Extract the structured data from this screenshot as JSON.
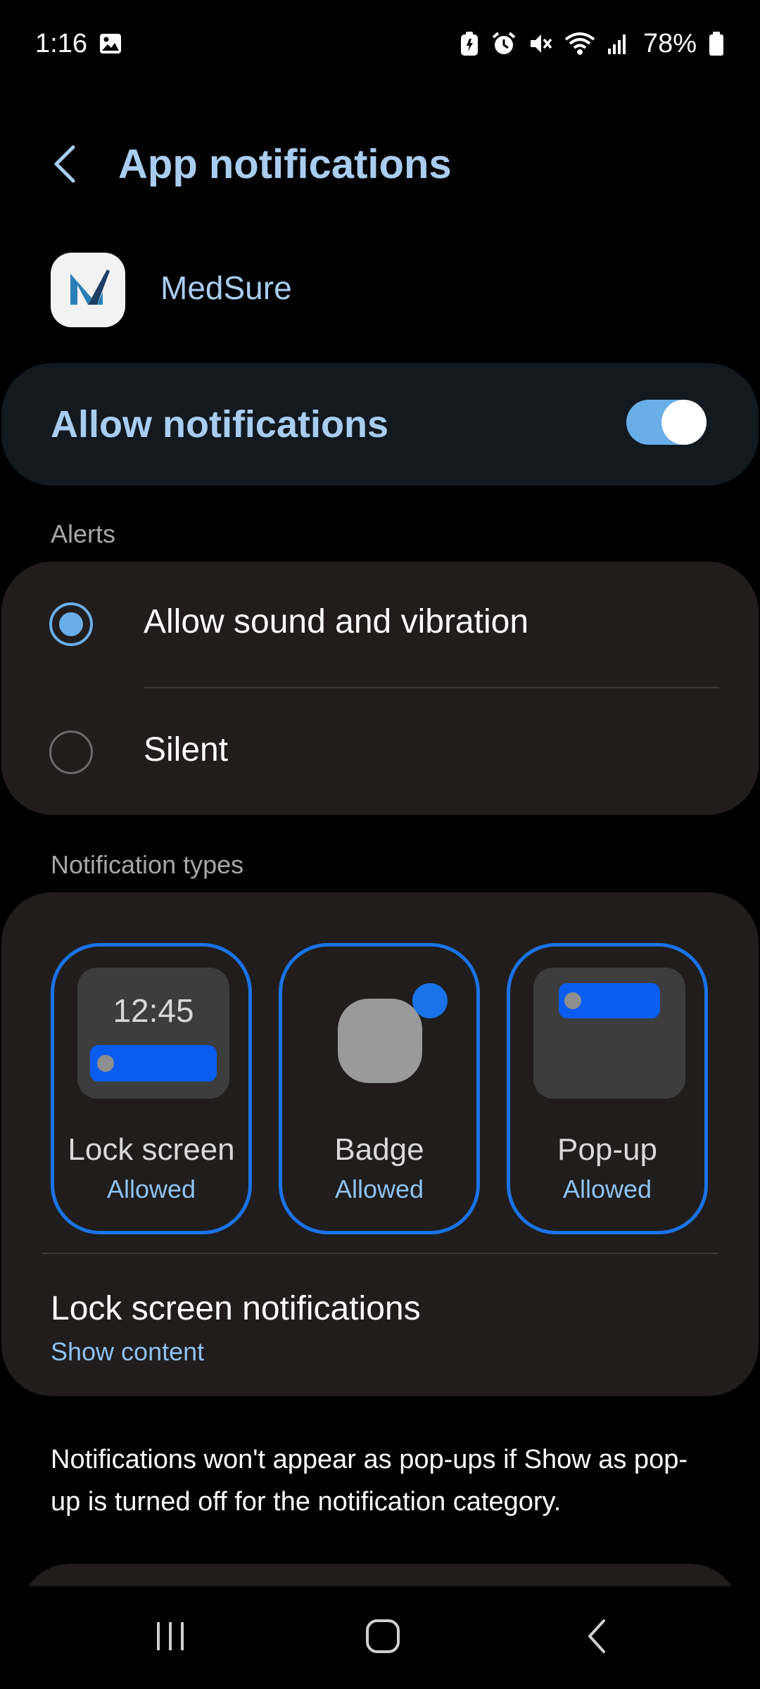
{
  "status_bar": {
    "time": "1:16",
    "battery_percent": "78%",
    "icons": [
      "image-icon",
      "battery-saver-icon",
      "alarm-icon",
      "mute-icon",
      "wifi-icon",
      "signal-icon",
      "battery-icon"
    ]
  },
  "header": {
    "title": "App notifications",
    "back_icon": "chevron-left-icon"
  },
  "app": {
    "name": "MedSure",
    "icon": "medsure-logo"
  },
  "allow_notifications": {
    "label": "Allow notifications",
    "enabled": true
  },
  "alerts": {
    "header": "Alerts",
    "options": [
      {
        "label": "Allow sound and vibration",
        "selected": true
      },
      {
        "label": "Silent",
        "selected": false
      }
    ]
  },
  "notification_types": {
    "header": "Notification types",
    "tiles": [
      {
        "label": "Lock screen",
        "status": "Allowed",
        "preview_time": "12:45"
      },
      {
        "label": "Badge",
        "status": "Allowed"
      },
      {
        "label": "Pop-up",
        "status": "Allowed"
      }
    ],
    "lock_screen_notifications": {
      "title": "Lock screen notifications",
      "value": "Show content"
    }
  },
  "footnote": "Notifications won't appear as pop-ups if Show as pop-up is turned off for the notification category.",
  "nav_bar": {
    "buttons": [
      "recents-icon",
      "home-icon",
      "back-icon"
    ]
  },
  "colors": {
    "accent": "#a9cdf0",
    "toggle_on": "#6aaee8",
    "tile_border": "#1a73e8",
    "card_bg": "#201d1c",
    "allow_card_bg": "#121a20"
  }
}
